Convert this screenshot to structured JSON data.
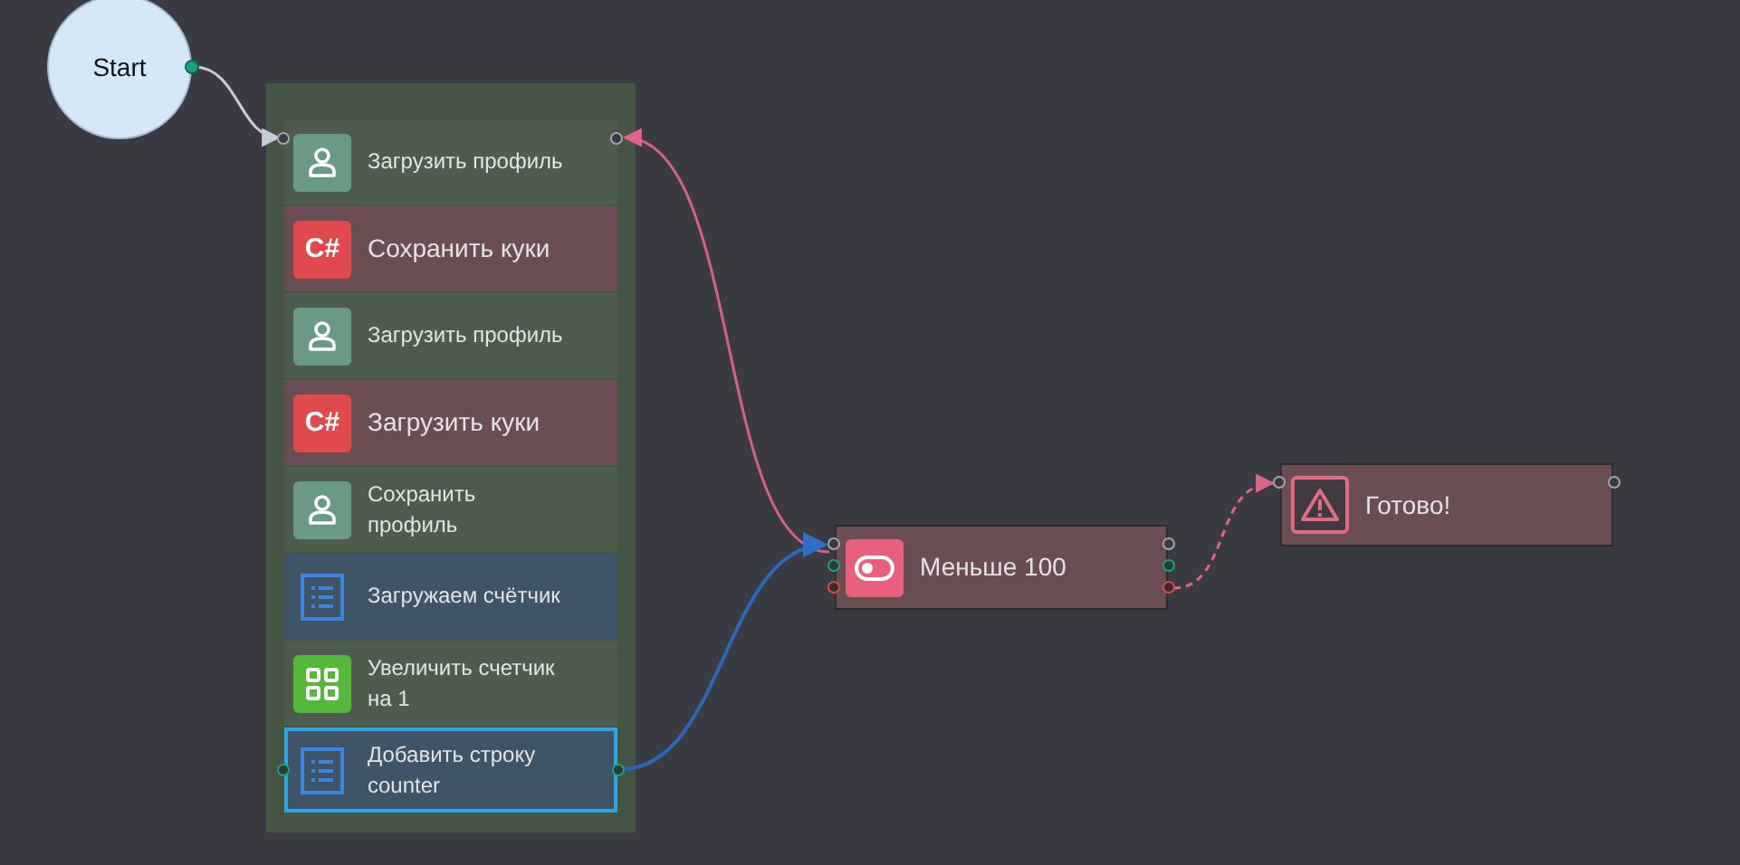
{
  "start": {
    "label": "Start"
  },
  "group": {
    "items": [
      {
        "kind": "user",
        "label": "Загрузить профиль",
        "selected": false
      },
      {
        "kind": "csharp",
        "icon_text": "C#",
        "label": "Сохранить куки",
        "selected": false
      },
      {
        "kind": "user",
        "label": "Загрузить профиль",
        "selected": false
      },
      {
        "kind": "csharp",
        "icon_text": "C#",
        "label": "Загрузить куки",
        "selected": false
      },
      {
        "kind": "user",
        "label": "Сохранить профиль",
        "selected": false
      },
      {
        "kind": "list",
        "label": "Загружаем счётчик",
        "selected": false
      },
      {
        "kind": "grid",
        "label": "Увеличить счетчик на 1",
        "selected": false
      },
      {
        "kind": "list",
        "label": "Добавить строку counter",
        "selected": true
      }
    ]
  },
  "condition": {
    "label": "Меньше 100"
  },
  "alert": {
    "label": "Готово!"
  }
}
